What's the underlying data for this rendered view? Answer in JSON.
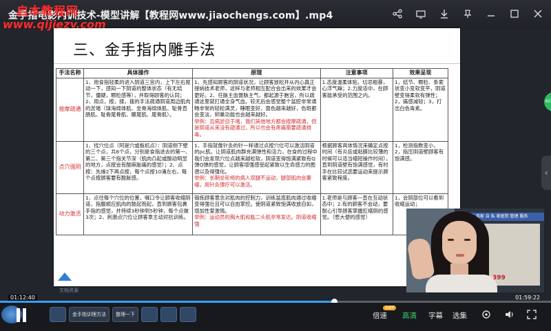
{
  "window": {
    "title": "金手指电影内训技术-模型讲解【教程网www.jiaochengs.com】.mp4",
    "watermark_top": "启本教程网",
    "watermark_url": "www.qijiezy.com"
  },
  "top_icons": [
    "share-icon",
    "tv-icon",
    "download-icon",
    "pin-icon",
    "minimize-icon",
    "restore-icon",
    "close-icon"
  ],
  "slide": {
    "title": "三、金手指内雕手法",
    "table": {
      "headers": [
        "手法名称",
        "具体操作",
        "原理",
        "注意事项",
        "效果呈现"
      ],
      "rows": [
        {
          "name": "按摩疏通",
          "ops": "1、用食指轻柔的进入阴道三宫内，上下左右晃动一下，感知一下阴道的整体状态（有无结节，僵硬，颗粒感等），并取得顾客的认同；2、用点，按，揉，拨的手法疏通阴道周边肌肉的淤堵（球海绵体肌、坐骨海绵体肌、耻骨直肠肌、耻骨尾骨肌、髂尾肌、尾骨肌）。",
          "principle_main": "1、先感知顾客的阴道状况，让顾客放松并从内心真正接纳技术老师，这样与老师相互配合会出来的效果才会更好。2、任脉主血督脉主气，都起源于胞宫，所以疏通这里就打通全身气血。较无后会感觉整个盆腔非常通畅非常的轻松满灵，睡眠变好，面色越来越好，色斑都会变淡，卵巢功能也会越来越好。",
          "principle_ex": "举例：百病淤自于堵，我们其他地方都会按摩疏通，但是阴道从来没有疏通过，所以也会有疼痛需要疏通排毒。",
          "notes": "1.态度温柔体贴，切忌粗暴，心浮气躁；2.力度适中，在顾客能承受的范围之内。",
          "effect": "1，结节、颗粒、条索状变小变软变平，阴道壁变得柔软有弹性；2，痛感减轻；3，打出白色毒素。"
        },
        {
          "name": "点穴强阴",
          "ops": "1、找穴位点（阿是穴或板机点）：阴道侧下壁的三个点，共6个点，分别是食指进去的第一、第二、第三个指关节深（肌肉凸起或酸动明显的地方，点按会有酸麻胀痛的感觉）；2、点按：先缘2下再点按，每个点按10涌左右，每个点按顾客要有酸胀感。",
          "principle_main": "1、手指就像针灸的针一样通过点按穴位可以激活阴道的pc肌，让阴道肌肉群充满弹性和活力，在食的过程中我们会发现穴位点越来越松软，阴道变得饱满紧致有Q弹Q弹的感觉，让顾客增强感受起紧致以生命感力的图谱以及得强化。",
          "principle_ex": "举例：长期坐轮椅的病人双腿不运动，腿部肌肉会萎缩，用针灸理疗可以激活。",
          "notes": "根据顾客具体情况来确定点按时间（有炎症或粘膜比较薄的时候可以适当缩短操作时间），直到阴道壁有饱满感觉，有时手在比较试选要运动来提示顾客紧致程度。",
          "effect": "1，检测指数变小，2，指压阴道壁顾客有饱满感。"
        },
        {
          "name": "动力激活",
          "ops": "1、点住每个穴位的位置，嘱口令让顾客收缩阴道，指腹顺应肌肉的鼓起而起，直到顾客包裹手指的感觉，并持续3秒钟到5秒钟，每个点做3次；2、刺激点穴位让顾客拿主动对抗训练。",
          "principle_main": "锻炼顾客意念对肌肉的控制力，训练盆底肌肉通过收缩变得强壮且可以自由掌控。使阴道紧致饱满收放自如，增加性爱激情。",
          "principle_ex": "举例：运动员的胸大肌和肱二头肌非常发达。阴道收缩强",
          "notes": "1.老师是与顾客一直在互动状态中；2.有的顾客不会动，要耐心引导顾客掌握肛缩阴的感觉。（憋大便的感觉）",
          "effect": "1，会阴部位可以看到收缩运动；"
        }
      ]
    }
  },
  "presenter": {
    "banner": "十年 商家 自 私 家庭院 管理 服务",
    "poster_number": "399"
  },
  "side": {
    "green_tab": "65"
  },
  "player": {
    "time_current": "01:12:40",
    "time_total": "01:59:22",
    "progress": 0.606,
    "strip_text": "文档资源",
    "controls": {
      "speed": "倍速",
      "speed_badge": "SWP",
      "quality": "高清",
      "subtitle": "字幕",
      "select": "选集"
    }
  },
  "taskbar": {
    "items": [
      "金手指训理方法",
      "整理一下"
    ]
  }
}
